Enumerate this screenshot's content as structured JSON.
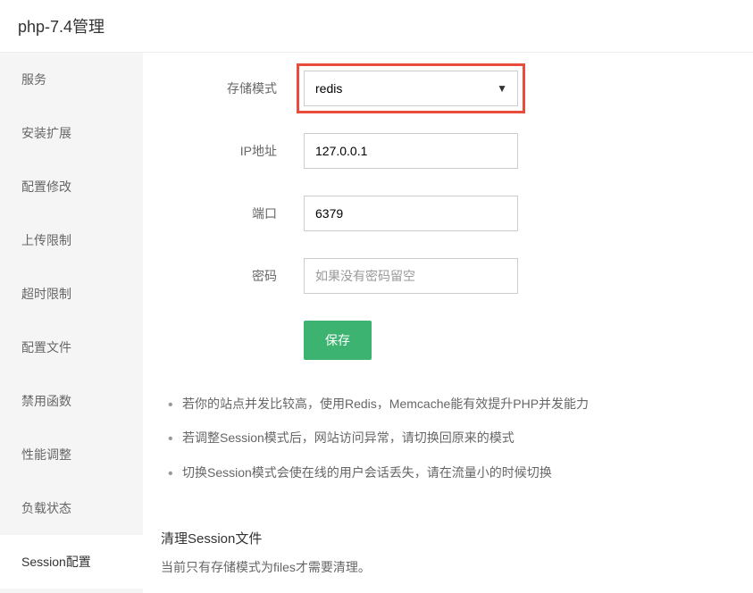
{
  "header": {
    "title": "php-7.4管理"
  },
  "sidebar": {
    "items": [
      {
        "label": "服务"
      },
      {
        "label": "安装扩展"
      },
      {
        "label": "配置修改"
      },
      {
        "label": "上传限制"
      },
      {
        "label": "超时限制"
      },
      {
        "label": "配置文件"
      },
      {
        "label": "禁用函数"
      },
      {
        "label": "性能调整"
      },
      {
        "label": "负载状态"
      },
      {
        "label": "Session配置"
      }
    ],
    "activeIndex": 9
  },
  "form": {
    "storage_mode": {
      "label": "存储模式",
      "value": "redis"
    },
    "ip_address": {
      "label": "IP地址",
      "value": "127.0.0.1"
    },
    "port": {
      "label": "端口",
      "value": "6379"
    },
    "password": {
      "label": "密码",
      "placeholder": "如果没有密码留空",
      "value": ""
    },
    "save_button": "保存"
  },
  "notes": {
    "items": [
      "若你的站点并发比较高，使用Redis，Memcache能有效提升PHP并发能力",
      "若调整Session模式后，网站访问异常，请切换回原来的模式",
      "切换Session模式会使在线的用户会话丢失，请在流量小的时候切换"
    ]
  },
  "clear_section": {
    "title": "清理Session文件",
    "desc": "当前只有存储模式为files才需要清理。"
  }
}
